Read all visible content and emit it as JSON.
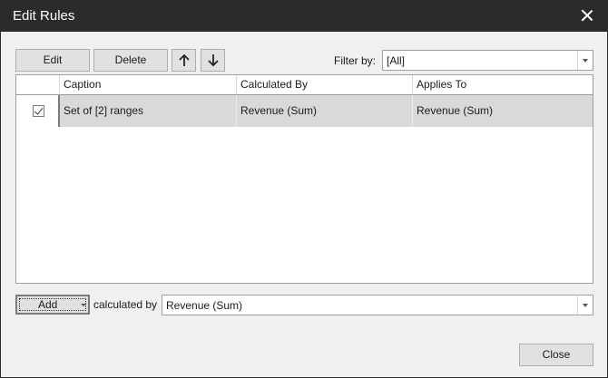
{
  "window": {
    "title": "Edit Rules"
  },
  "toolbar": {
    "edit_label": "Edit",
    "delete_label": "Delete",
    "move_up_icon": "arrow-up-icon",
    "move_down_icon": "arrow-down-icon"
  },
  "filter": {
    "label": "Filter by:",
    "value": "[All]"
  },
  "table": {
    "columns": [
      "",
      "Caption",
      "Calculated By",
      "Applies To"
    ],
    "rows": [
      {
        "checked": true,
        "caption": "Set of [2] ranges",
        "calculated_by": "Revenue (Sum)",
        "applies_to": "Revenue (Sum)"
      }
    ]
  },
  "footer": {
    "add_label": "Add",
    "calculated_by_label": "calculated by",
    "calculated_by_value": "Revenue (Sum)",
    "close_label": "Close"
  },
  "colors": {
    "titlebar": "#2b2b2b",
    "selected_row": "#d9d9d9",
    "dialog_bg": "#f0f0f0"
  }
}
